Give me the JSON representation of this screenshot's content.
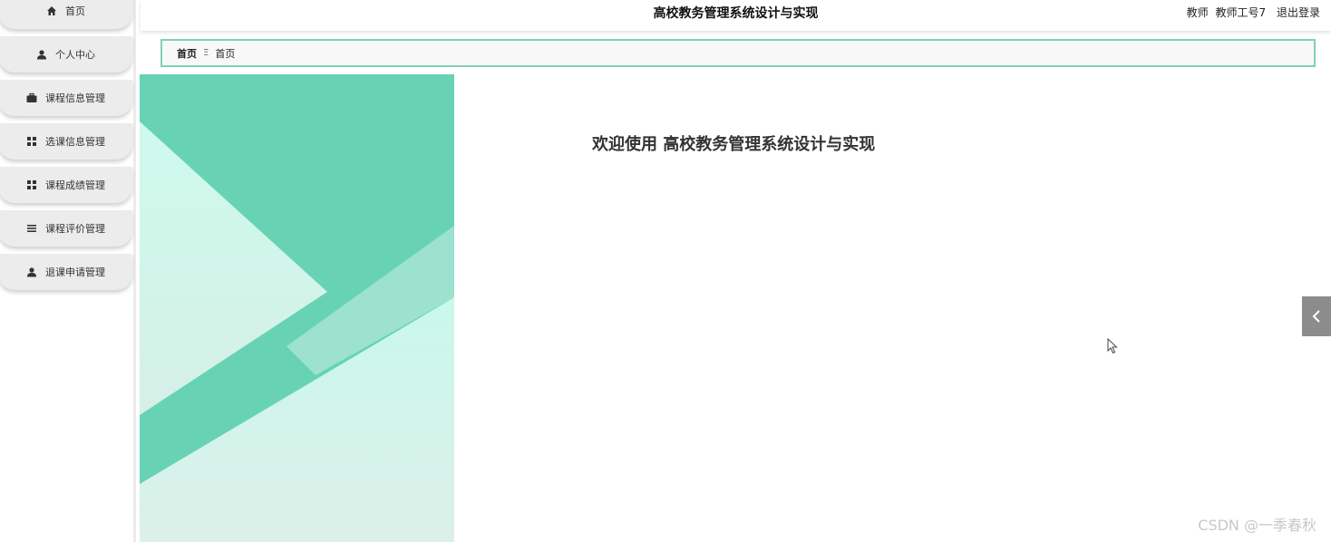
{
  "sidebar": {
    "items": [
      {
        "label": "首页",
        "icon": "home-icon"
      },
      {
        "label": "个人中心",
        "icon": "user-icon"
      },
      {
        "label": "课程信息管理",
        "icon": "briefcase-icon"
      },
      {
        "label": "选课信息管理",
        "icon": "grid-icon"
      },
      {
        "label": "课程成绩管理",
        "icon": "grid-icon"
      },
      {
        "label": "课程评价管理",
        "icon": "list-icon"
      },
      {
        "label": "退课申请管理",
        "icon": "user-icon"
      }
    ]
  },
  "header": {
    "title": "高校教务管理系统设计与实现",
    "role": "教师",
    "username": "教师工号7",
    "logout": "退出登录"
  },
  "breadcrumb": {
    "home": "首页",
    "separator": "Ξ",
    "current": "首页"
  },
  "main": {
    "welcome": "欢迎使用 高校教务管理系统设计与实现"
  },
  "watermark": "CSDN @一季春秋",
  "colors": {
    "accent": "#67d3b4",
    "light_accent": "#c9f7e9",
    "breadcrumb_border": "#7fd0b6"
  }
}
